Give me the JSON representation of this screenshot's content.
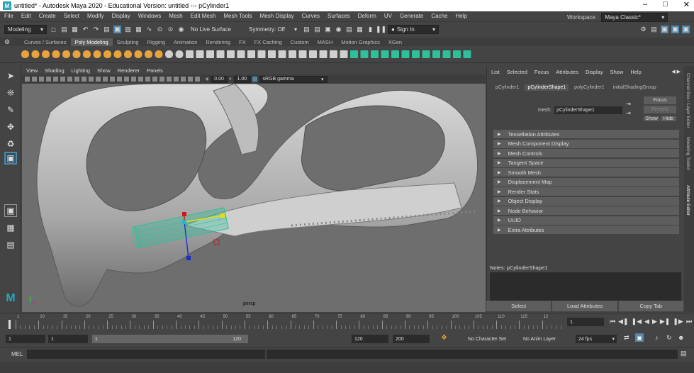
{
  "window": {
    "title": "untitled* - Autodesk Maya 2020 - Educational Version: untitled    ---    pCylinder1",
    "app_icon": "M",
    "controls": [
      "minimize-icon",
      "maximize-icon",
      "close-icon"
    ]
  },
  "menubar": [
    "File",
    "Edit",
    "Create",
    "Select",
    "Modify",
    "Display",
    "Windows",
    "Mesh",
    "Edit Mesh",
    "Mesh Tools",
    "Mesh Display",
    "Curves",
    "Surfaces",
    "Deform",
    "UV",
    "Generate",
    "Cache",
    "Help"
  ],
  "workspace": {
    "label": "Workspace :",
    "value": "Maya Classic*"
  },
  "statusline": {
    "mode": "Modeling",
    "live_surface": "No Live Surface",
    "symmetry": "Symmetry: Off",
    "sign_in": "Sign In"
  },
  "shelf_tabs": [
    "Curves / Surfaces",
    "Poly Modeling",
    "Sculpting",
    "Rigging",
    "Animation",
    "Rendering",
    "FX",
    "FX Caching",
    "Custom",
    "MASH",
    "Motion Graphics",
    "XGen"
  ],
  "shelf_active_tab": "Poly Modeling",
  "viewport": {
    "menu": [
      "View",
      "Shading",
      "Lighting",
      "Show",
      "Renderer",
      "Panels"
    ],
    "exposure": "0.00",
    "gamma": "1.00",
    "color_space": "sRGB gamma",
    "camera_label": "persp"
  },
  "attribute_editor": {
    "menu": [
      "List",
      "Selected",
      "Focus",
      "Attributes",
      "Display",
      "Show",
      "Help"
    ],
    "node_tabs": [
      "pCylinder1",
      "pCylinderShape1",
      "polyCylinder1",
      "initialShadingGroup"
    ],
    "active_tab": "pCylinderShape1",
    "mesh_label": "mesh:",
    "mesh_value": "pCylinderShape1",
    "buttons": {
      "focus": "Focus",
      "presets": "Presets",
      "show": "Show",
      "hide": "Hide"
    },
    "sections": [
      "Tessellation Attributes",
      "Mesh Component Display",
      "Mesh Controls",
      "Tangent Space",
      "Smooth Mesh",
      "Displacement Map",
      "Render Stats",
      "Object Display",
      "Node Behavior",
      "UUID",
      "Extra Attributes"
    ],
    "notes_label": "Notes:  pCylinderShape1",
    "bottom_buttons": [
      "Select",
      "Load Attributes",
      "Copy Tab"
    ]
  },
  "side_tabs": [
    "Channel Box / Layer Editor",
    "Modeling Toolkit",
    "Attribute Editor"
  ],
  "timeline": {
    "ticks": [
      "1",
      "10",
      "15",
      "20",
      "25",
      "30",
      "35",
      "40",
      "45",
      "50",
      "55",
      "60",
      "65",
      "70",
      "75",
      "80",
      "85",
      "90",
      "95",
      "100",
      "105",
      "110",
      "115",
      "12"
    ],
    "current_frame": "1"
  },
  "range": {
    "start": "1",
    "start2": "1",
    "slider_start": "1",
    "slider_end": "120",
    "end": "120",
    "end2": "200",
    "character_set": "No Character Set",
    "anim_layer": "No Anim Layer",
    "fps": "24 fps"
  },
  "command_line": {
    "label": "MEL"
  },
  "colors": {
    "accent": "#5285a6",
    "shelf_orange": "#e8a33d",
    "selection_green": "#2fbf9a",
    "annotation_red": "#c8171d"
  }
}
